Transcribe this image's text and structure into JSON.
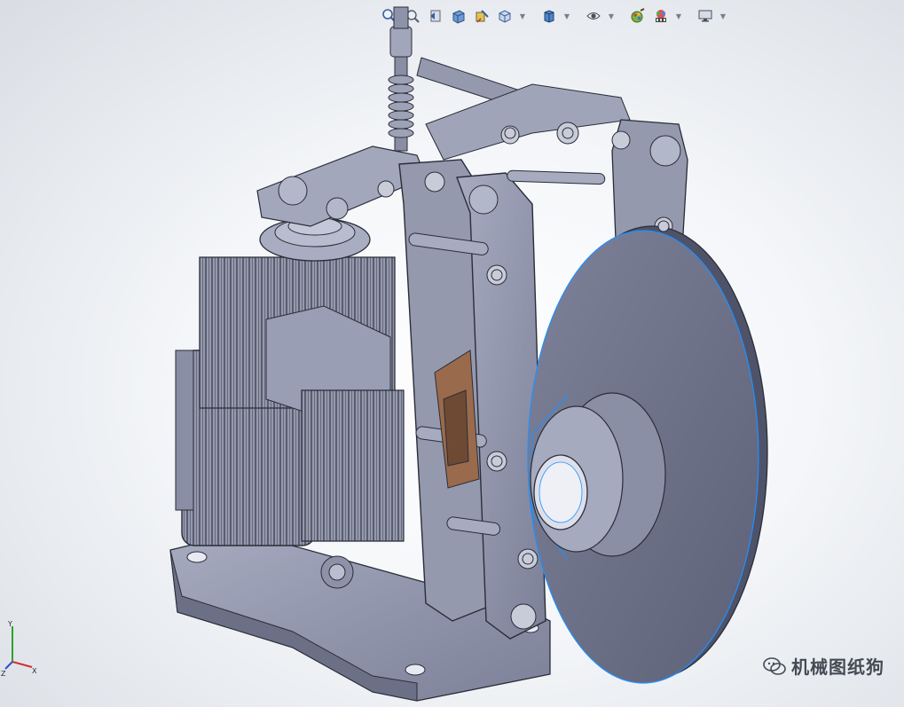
{
  "toolbar": {
    "items": [
      {
        "name": "zoom-to-fit",
        "icon": "magnifier-icon"
      },
      {
        "name": "zoom-to-area",
        "icon": "zoom-area-icon"
      },
      {
        "name": "previous-view",
        "icon": "previous-view-icon"
      },
      {
        "name": "section-view",
        "icon": "section-view-icon"
      },
      {
        "name": "dynamic-annotation",
        "icon": "annotation-icon"
      },
      {
        "name": "view-orientation",
        "icon": "cube-orientation-icon",
        "dropdown": true
      },
      {
        "name": "display-style",
        "icon": "display-style-icon",
        "dropdown": true
      },
      {
        "name": "hide-show-items",
        "icon": "eye-icon",
        "dropdown": true
      },
      {
        "name": "edit-appearance",
        "icon": "appearance-icon"
      },
      {
        "name": "apply-scene",
        "icon": "scene-icon",
        "dropdown": true
      },
      {
        "name": "view-settings",
        "icon": "monitor-icon",
        "dropdown": true
      }
    ]
  },
  "triad": {
    "x_label": "X",
    "y_label": "Y",
    "z_label": "Z"
  },
  "watermark": {
    "text": "机械图纸狗"
  },
  "colors": {
    "part": "#8c90a6",
    "edge": "#2a2d38",
    "selection": "#1e90ff"
  }
}
